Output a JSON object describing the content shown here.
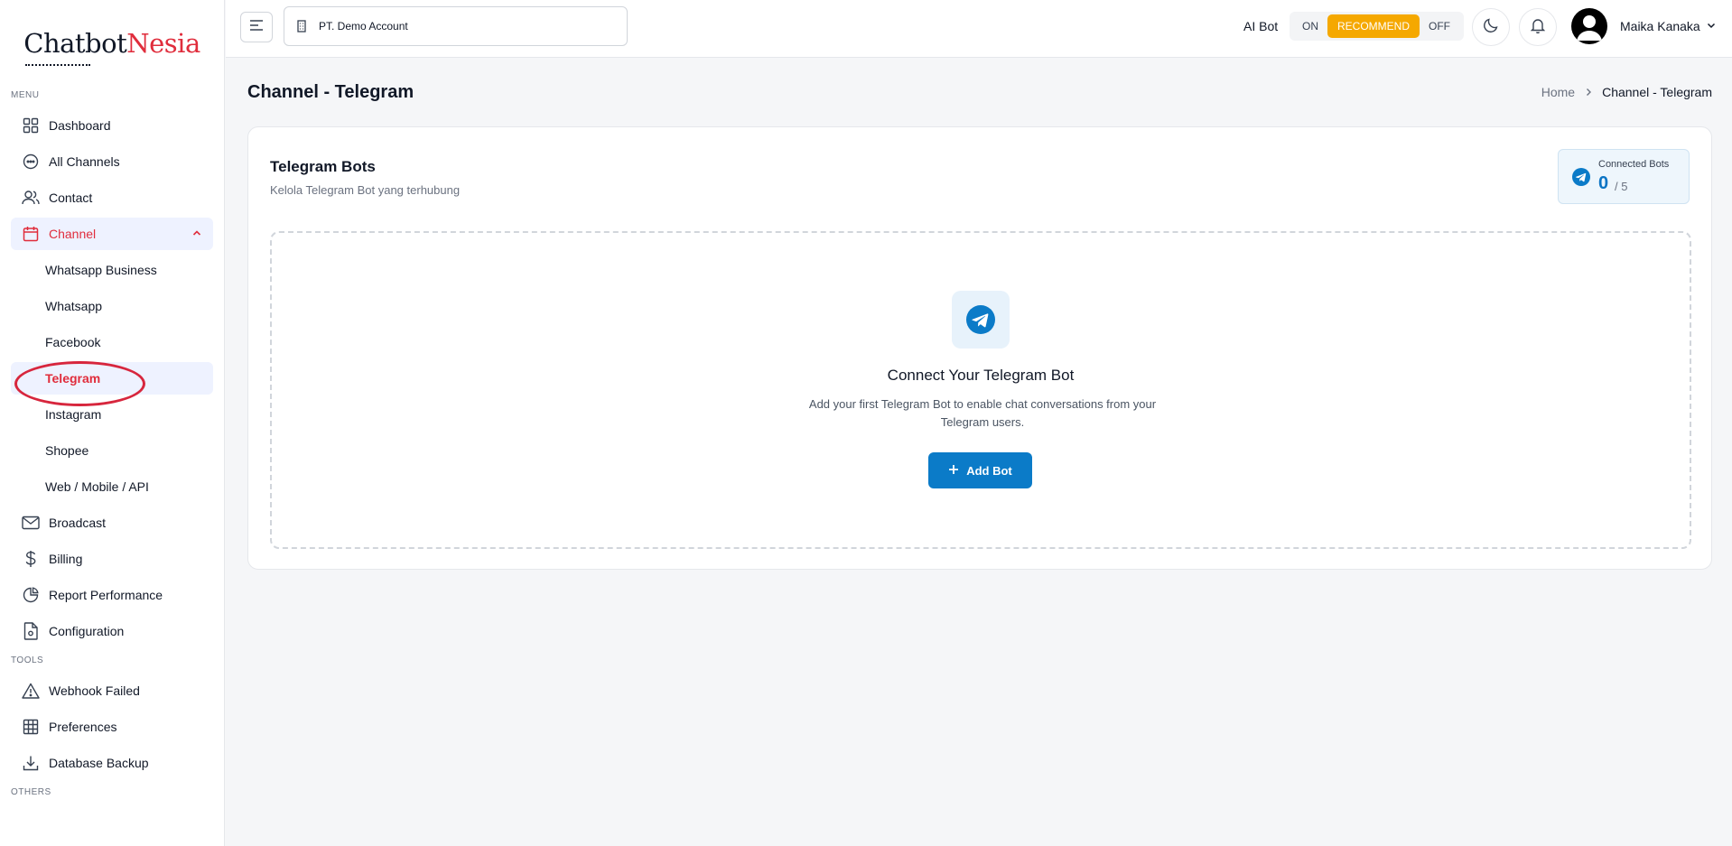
{
  "brand": {
    "part1": "Chatbot",
    "part2": "Nesia"
  },
  "sidebar": {
    "menu_label": "MENU",
    "tools_label": "TOOLS",
    "others_label": "OTHERS",
    "items": [
      {
        "label": "Dashboard"
      },
      {
        "label": "All Channels"
      },
      {
        "label": "Contact"
      },
      {
        "label": "Channel"
      }
    ],
    "channel_sub": [
      {
        "label": "Whatsapp Business"
      },
      {
        "label": "Whatsapp"
      },
      {
        "label": "Facebook"
      },
      {
        "label": "Telegram"
      },
      {
        "label": "Instagram"
      },
      {
        "label": "Shopee"
      },
      {
        "label": "Web / Mobile / API"
      }
    ],
    "items_after": [
      {
        "label": "Broadcast"
      },
      {
        "label": "Billing"
      },
      {
        "label": "Report Performance"
      },
      {
        "label": "Configuration"
      }
    ],
    "tools": [
      {
        "label": "Webhook Failed"
      },
      {
        "label": "Preferences"
      },
      {
        "label": "Database Backup"
      }
    ]
  },
  "topbar": {
    "account": "PT. Demo Account",
    "ai_bot_label": "AI Bot",
    "toggle": {
      "on": "ON",
      "recommend": "RECOMMEND",
      "off": "OFF",
      "selected": "RECOMMEND"
    },
    "user_name": "Maika Kanaka"
  },
  "page": {
    "title": "Channel - Telegram",
    "breadcrumb": {
      "home": "Home",
      "current": "Channel - Telegram"
    }
  },
  "card": {
    "title": "Telegram Bots",
    "subtitle": "Kelola Telegram Bot yang terhubung",
    "connected": {
      "label": "Connected Bots",
      "count": "0",
      "max": "/ 5"
    },
    "empty": {
      "title": "Connect Your Telegram Bot",
      "description": "Add your first Telegram Bot to enable chat conversations from your Telegram users.",
      "button": "Add Bot"
    }
  },
  "colors": {
    "accent_red": "#e02d3c",
    "telegram_blue": "#0b7bc8",
    "recommend_yellow": "#f5a800"
  }
}
